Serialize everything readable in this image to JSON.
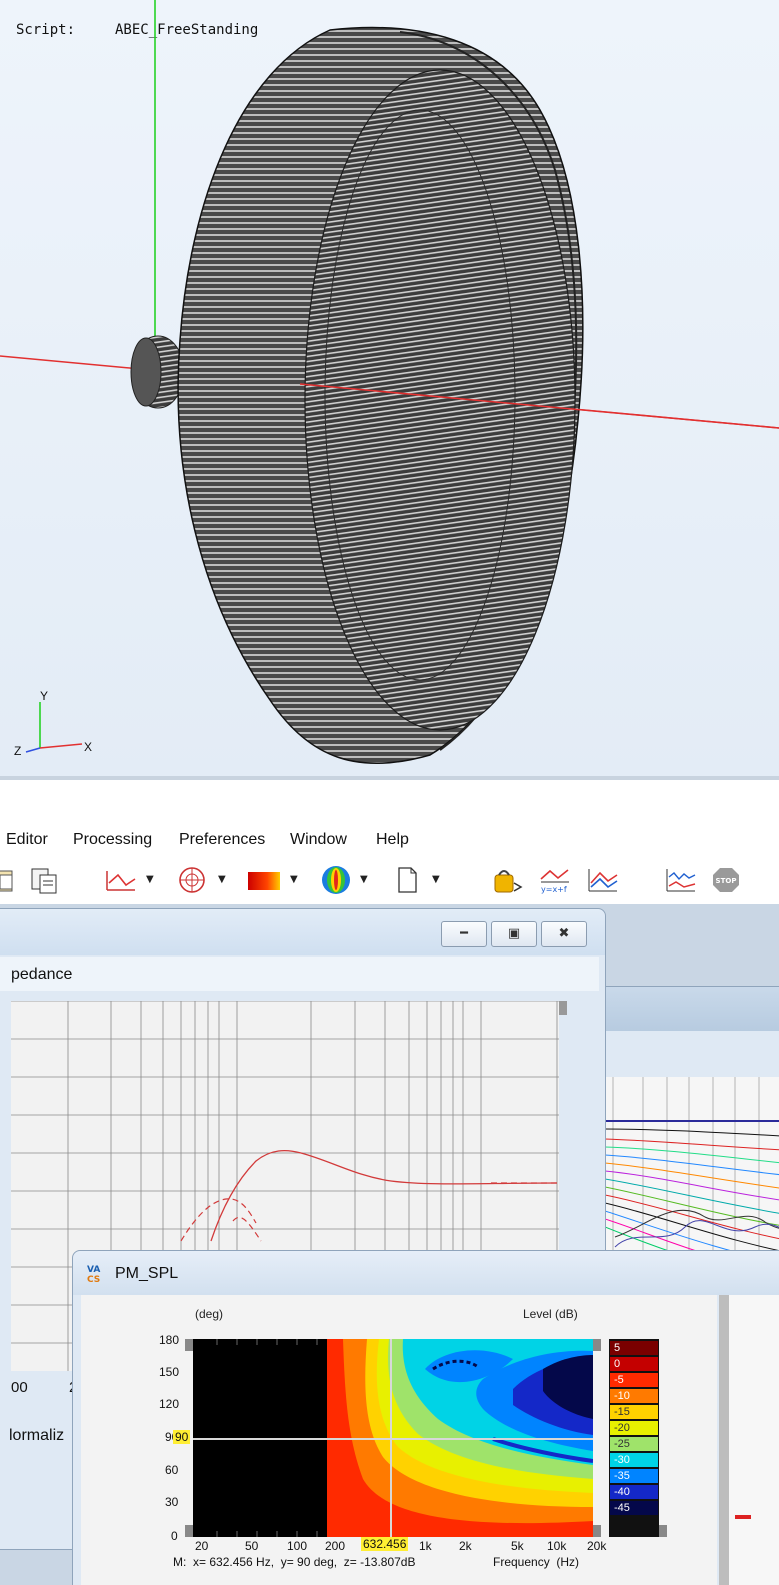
{
  "viewport": {
    "script_label": "Script:",
    "script_name": "ABEC_FreeStanding",
    "axis_gizmo": {
      "y": "Y",
      "x": "X",
      "z": "Z"
    }
  },
  "menubar": {
    "items": [
      "Editor",
      "Processing",
      "Preferences",
      "Window",
      "Help"
    ]
  },
  "toolbar": {
    "icons": [
      "paste-icon",
      "copy-special-icon",
      "line-graph-icon",
      "polar-graph-icon",
      "color-map-icon",
      "balloon-icon",
      "new-document-icon",
      "scripting-icon",
      "formula-icon",
      "compare-icon",
      "export-graph-icon",
      "stop-icon"
    ],
    "stop_label": "STOP",
    "formula_label": "y=x+f"
  },
  "impedance_window": {
    "tab_partial": "pedance",
    "x_tick_partial": "00",
    "x_tick_partial2": "2",
    "bottom_partial": "lormaliz",
    "colors": {
      "curve": "#d23a3a"
    }
  },
  "pm_spl_window": {
    "title": "PM_SPL",
    "logo": {
      "top": "VA",
      "bottom": "CS"
    },
    "y_axis_unit": "(deg)",
    "level_axis_unit": "Level  (dB)",
    "y_ticks": [
      "180",
      "150",
      "120",
      "90",
      "60",
      "30",
      "0"
    ],
    "y_marker": "90",
    "x_ticks": [
      "20",
      "50",
      "100",
      "200",
      "1k",
      "2k",
      "5k",
      "10k",
      "20k"
    ],
    "x_marker": "632.456",
    "x_axis_label": "Frequency  (Hz)",
    "status": "M:  x= 632.456 Hz,  y= 90 deg,  z= -13.807dB",
    "legend": [
      {
        "label": "5",
        "color": "#7a0000"
      },
      {
        "label": "0",
        "color": "#c40000"
      },
      {
        "label": "-5",
        "color": "#ff2a00"
      },
      {
        "label": "-10",
        "color": "#ff7a00"
      },
      {
        "label": "-15",
        "color": "#ffd200"
      },
      {
        "label": "-20",
        "color": "#e8f000"
      },
      {
        "label": "-25",
        "color": "#9fe36a"
      },
      {
        "label": "-30",
        "color": "#00d3e6"
      },
      {
        "label": "-35",
        "color": "#0084ff"
      },
      {
        "label": "-40",
        "color": "#1428c8"
      },
      {
        "label": "-45",
        "color": "#04084a"
      }
    ]
  },
  "chart_data": {
    "type": "heatmap",
    "x_axis": "Frequency  (Hz)",
    "y_axis": "(deg)",
    "z_axis": "Level  (dB)",
    "xlim": [
      20,
      20000
    ],
    "ylim": [
      0,
      180
    ],
    "x_scale": "log",
    "cursor": {
      "x": 632.456,
      "y": 90,
      "z": -13.807
    }
  }
}
